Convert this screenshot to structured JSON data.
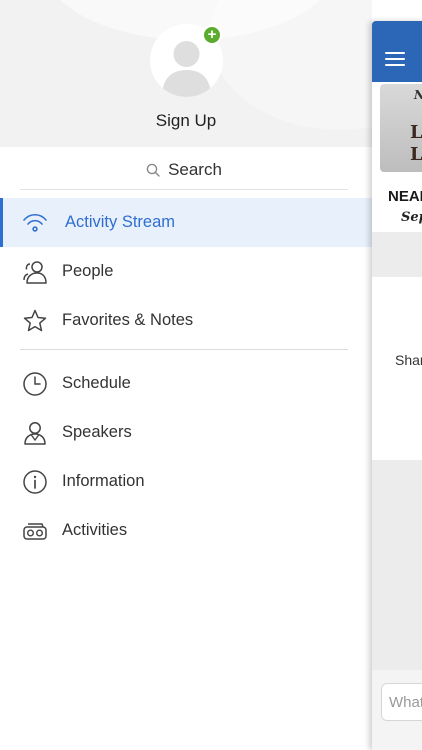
{
  "profile": {
    "signup_label": "Sign Up",
    "add_badge": "+"
  },
  "search": {
    "label": "Search"
  },
  "menu": {
    "items": [
      {
        "label": "Activity Stream",
        "icon": "wifi-icon",
        "active": true
      },
      {
        "label": "People",
        "icon": "people-icon",
        "active": false
      },
      {
        "label": "Favorites & Notes",
        "icon": "star-icon",
        "active": false
      },
      {
        "label": "Schedule",
        "icon": "clock-icon",
        "active": false
      },
      {
        "label": "Speakers",
        "icon": "speaker-person-icon",
        "active": false
      },
      {
        "label": "Information",
        "icon": "info-icon",
        "active": false
      },
      {
        "label": "Activities",
        "icon": "vr-goggles-icon",
        "active": false
      }
    ]
  },
  "main": {
    "banner_top": "N",
    "banner_line1": "L",
    "banner_line2": "L",
    "banner_near": "NEAI",
    "banner_sep": "Sep",
    "card_text": "Shar",
    "composer_placeholder": "What"
  },
  "colors": {
    "accent": "#2f6fd1",
    "header_blue": "#2c67b7",
    "badge_green": "#5aab2e",
    "active_bg": "#e8f0fb"
  }
}
